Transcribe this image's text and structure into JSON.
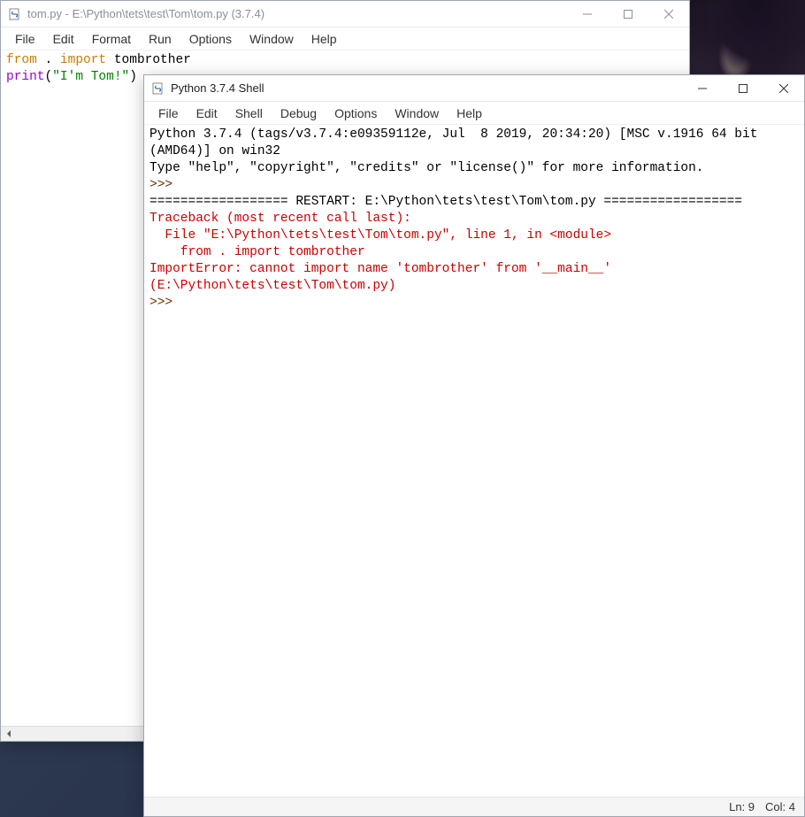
{
  "editor_window": {
    "title": "tom.py - E:\\Python\\tets\\test\\Tom\\tom.py (3.7.4)",
    "menus": [
      "File",
      "Edit",
      "Format",
      "Run",
      "Options",
      "Window",
      "Help"
    ],
    "code": {
      "from_kw": "from",
      "dot": " . ",
      "import_kw": "import",
      "mod": " tombrother",
      "print_fn": "print",
      "lparen": "(",
      "str": "\"I'm Tom!\"",
      "rparen": ")"
    }
  },
  "shell_window": {
    "title": "Python 3.7.4 Shell",
    "menus": [
      "File",
      "Edit",
      "Shell",
      "Debug",
      "Options",
      "Window",
      "Help"
    ],
    "banner1": "Python 3.7.4 (tags/v3.7.4:e09359112e, Jul  8 2019, 20:34:20) [MSC v.1916 64 bit (AMD64)] on win32",
    "banner2": "Type \"help\", \"copyright\", \"credits\" or \"license()\" for more information.",
    "prompt": ">>> ",
    "restart": "================== RESTART: E:\\Python\\tets\\test\\Tom\\tom.py ==================",
    "tb_header": "Traceback (most recent call last):",
    "tb_file": "  File \"E:\\Python\\tets\\test\\Tom\\tom.py\", line 1, in <module>",
    "tb_line": "    from . import tombrother",
    "tb_err": "ImportError: cannot import name 'tombrother' from '__main__' (E:\\Python\\tets\\test\\Tom\\tom.py)",
    "status_ln": "Ln: 9",
    "status_col": "Col: 4"
  }
}
